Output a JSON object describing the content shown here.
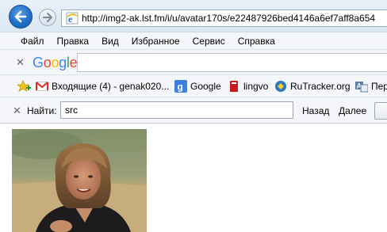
{
  "browser": {
    "address_url": "http://img2-ak.lst.fm/i/u/avatar170s/e22487926bed4146a6ef7aff8a654",
    "menu": [
      "Файл",
      "Правка",
      "Вид",
      "Избранное",
      "Сервис",
      "Справка"
    ],
    "google_toolbar": {
      "logo_text": "Google",
      "search_value": ""
    },
    "favorites": [
      {
        "label": "Входящие (4) - genak020...",
        "icon": "gmail-icon"
      },
      {
        "label": "Google",
        "icon": "google-icon"
      },
      {
        "label": "lingvo",
        "icon": "lingvo-icon"
      },
      {
        "label": "RuTracker.org",
        "icon": "rutracker-icon"
      },
      {
        "label": "Пер",
        "icon": "translate-icon"
      }
    ],
    "find": {
      "label": "Найти:",
      "value": "src",
      "prev_label": "Назад",
      "next_label": "Далее"
    }
  },
  "content": {
    "image_icon": "photo-portrait"
  },
  "colors": {
    "accent": "#1f6fc9",
    "chrome": "#f4f6f9"
  }
}
